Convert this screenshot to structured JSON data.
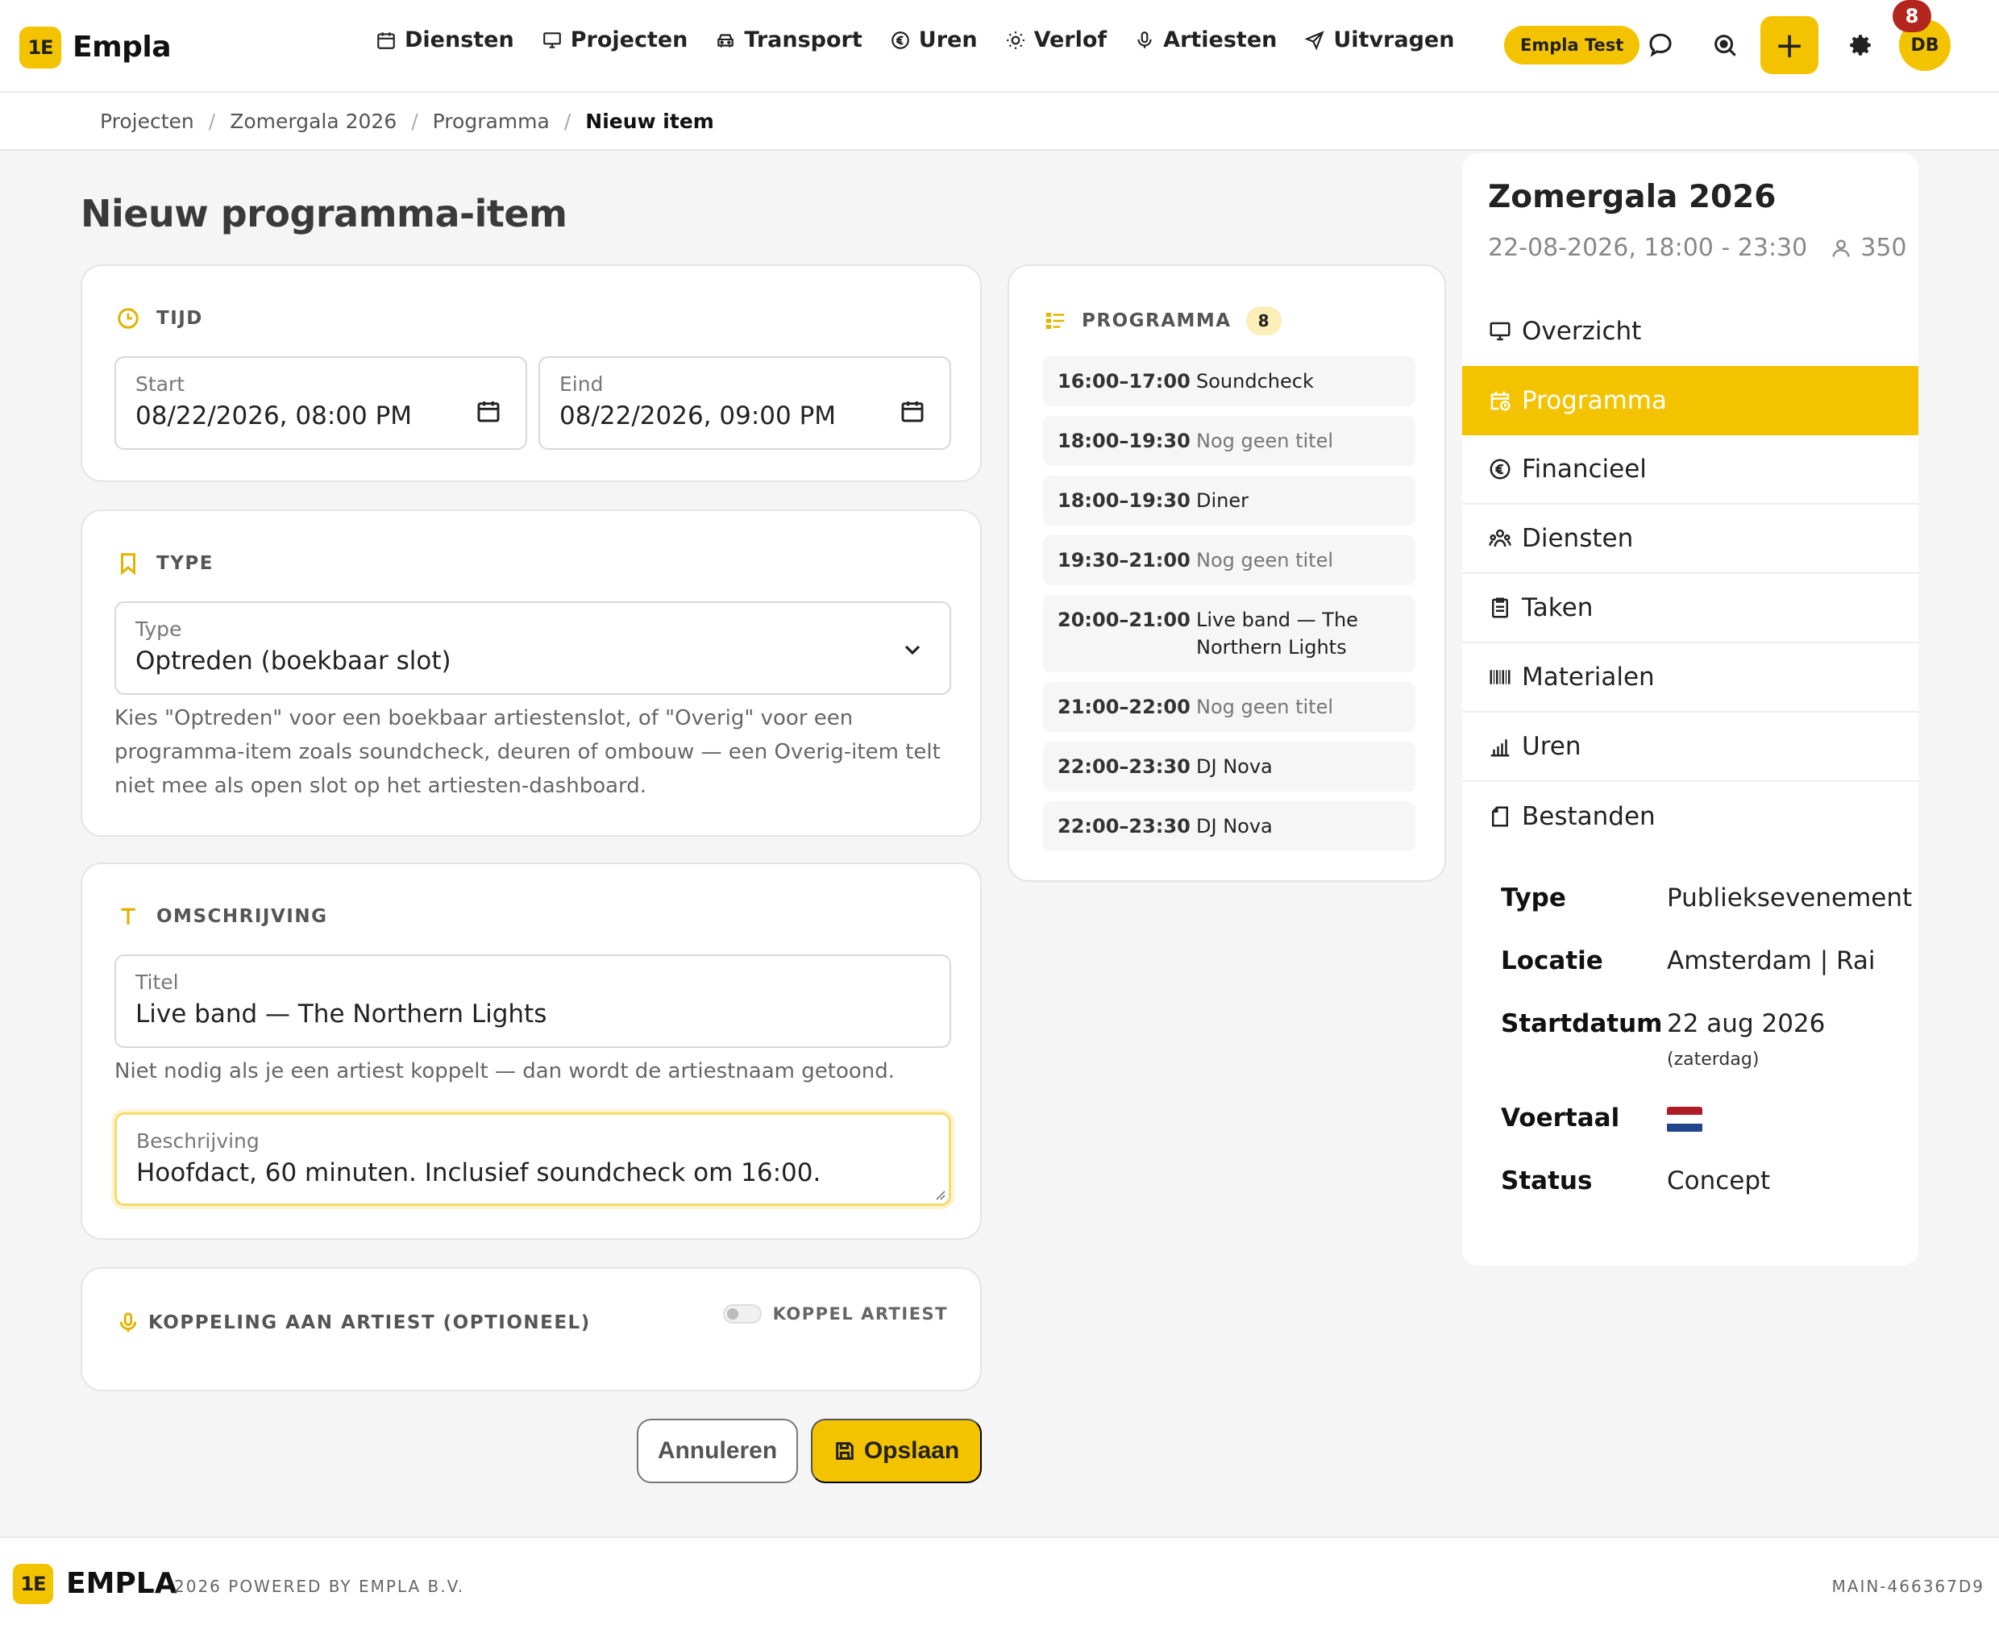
{
  "brand": {
    "logo": "1E",
    "name": "Empla"
  },
  "nav": [
    {
      "label": "Diensten",
      "icon": "calendar-icon"
    },
    {
      "label": "Projecten",
      "icon": "monitor-icon"
    },
    {
      "label": "Transport",
      "icon": "car-icon"
    },
    {
      "label": "Uren",
      "icon": "euro-icon"
    },
    {
      "label": "Verlof",
      "icon": "sun-icon"
    },
    {
      "label": "Artiesten",
      "icon": "microphone-icon"
    },
    {
      "label": "Uitvragen",
      "icon": "send-icon"
    }
  ],
  "header": {
    "environment": "Empla Test",
    "add_label": "+",
    "avatar_initials": "DB",
    "notifications": "8"
  },
  "breadcrumb": [
    "Projecten",
    "Zomergala 2026",
    "Programma",
    "Nieuw item"
  ],
  "page_title": "Nieuw programma-item",
  "tijd": {
    "heading": "TIJD",
    "start_label": "Start",
    "start_value": "08/22/2026, 08:00 PM",
    "end_label": "Eind",
    "end_value": "08/22/2026, 09:00 PM"
  },
  "type": {
    "heading": "TYPE",
    "label": "Type",
    "value": "Optreden (boekbaar slot)",
    "help": "Kies \"Optreden\" voor een boekbaar artiestenslot, of \"Overig\" voor een programma-item zoals soundcheck, deuren of ombouw — een Overig-item telt niet mee als open slot op het artiesten-dashboard."
  },
  "omschrijving": {
    "heading": "OMSCHRIJVING",
    "title_label": "Titel",
    "title_value": "Live band — The Northern Lights",
    "title_help": "Niet nodig als je een artiest koppelt — dan wordt de artiestnaam getoond.",
    "desc_label": "Beschrijving",
    "desc_value": "Hoofdact, 60 minuten. Inclusief soundcheck om 16:00."
  },
  "koppeling": {
    "heading": "KOPPELING AAN ARTIEST (OPTIONEEL)",
    "toggle_label": "KOPPEL ARTIEST"
  },
  "actions": {
    "cancel": "Annuleren",
    "save": "Opslaan"
  },
  "programma": {
    "heading": "PROGRAMMA",
    "count": "8",
    "items": [
      {
        "time": "16:00–17:00",
        "name": "Soundcheck",
        "muted": false
      },
      {
        "time": "18:00–19:30",
        "name": "Nog geen titel",
        "muted": true
      },
      {
        "time": "18:00–19:30",
        "name": "Diner",
        "muted": false
      },
      {
        "time": "19:30–21:00",
        "name": "Nog geen titel",
        "muted": true
      },
      {
        "time": "20:00–21:00",
        "name": "Live band — The Northern Lights",
        "muted": false
      },
      {
        "time": "21:00–22:00",
        "name": "Nog geen titel",
        "muted": true
      },
      {
        "time": "22:00–23:30",
        "name": "DJ Nova",
        "muted": false
      },
      {
        "time": "22:00–23:30",
        "name": "DJ Nova",
        "muted": false
      }
    ]
  },
  "project": {
    "title": "Zomergala 2026",
    "datetime": "22-08-2026, 18:00 - 23:30",
    "guests": "350",
    "menu": [
      {
        "label": "Overzicht",
        "icon": "monitor-icon",
        "active": false
      },
      {
        "label": "Programma",
        "icon": "calendar-clock-icon",
        "active": true
      },
      {
        "label": "Financieel",
        "icon": "euro-icon",
        "active": false
      },
      {
        "label": "Diensten",
        "icon": "people-icon",
        "active": false
      },
      {
        "label": "Taken",
        "icon": "clipboard-icon",
        "active": false
      },
      {
        "label": "Materialen",
        "icon": "barcode-icon",
        "active": false
      },
      {
        "label": "Uren",
        "icon": "bar-chart-icon",
        "active": false
      },
      {
        "label": "Bestanden",
        "icon": "file-icon",
        "active": false
      }
    ],
    "meta": {
      "type_label": "Type",
      "type_value": "Publieksevenement",
      "locatie_label": "Locatie",
      "locatie_value": "Amsterdam | Rai",
      "startdatum_label": "Startdatum",
      "startdatum_value": "22 aug 2026",
      "startdatum_note": "(zaterdag)",
      "voertaal_label": "Voertaal",
      "voertaal_flag": "nl-flag",
      "status_label": "Status",
      "status_value": "Concept"
    }
  },
  "footer": {
    "logo": "1E",
    "brand": "EMPLA",
    "powered": "2026 POWERED BY EMPLA B.V.",
    "version": "MAIN-466367D9"
  },
  "colors": {
    "accent": "#f4c300",
    "badge_red": "#b3261e"
  }
}
